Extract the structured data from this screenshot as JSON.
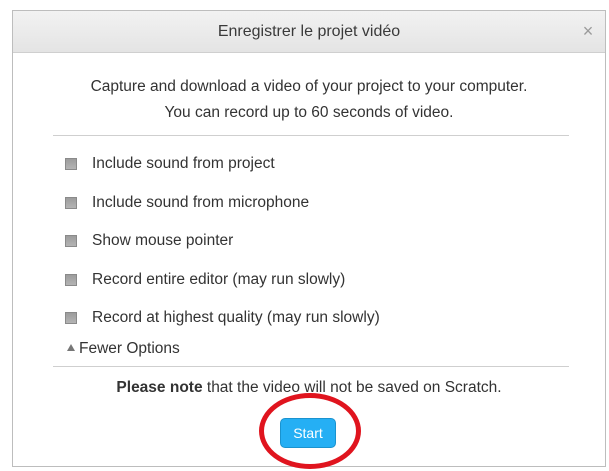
{
  "dialog": {
    "title": "Enregistrer le projet vidéo",
    "close_glyph": "×",
    "intro_line1": "Capture and download a video of your project to your computer.",
    "intro_line2": "You can record up to 60 seconds of video.",
    "options": [
      {
        "label": "Include sound from project",
        "checked": false
      },
      {
        "label": "Include sound from microphone",
        "checked": false
      },
      {
        "label": "Show mouse pointer",
        "checked": false
      },
      {
        "label": "Record entire editor (may run slowly)",
        "checked": false
      },
      {
        "label": "Record at highest quality (may run slowly)",
        "checked": false
      }
    ],
    "toggle_label": "Fewer Options",
    "note_bold": "Please note",
    "note_rest": " that the video will not be saved on Scratch.",
    "start_label": "Start"
  },
  "colors": {
    "accent": "#25aff4",
    "highlight": "#e0141e"
  },
  "icons": {
    "close": "close-icon",
    "toggle": "triangle-up-icon"
  }
}
